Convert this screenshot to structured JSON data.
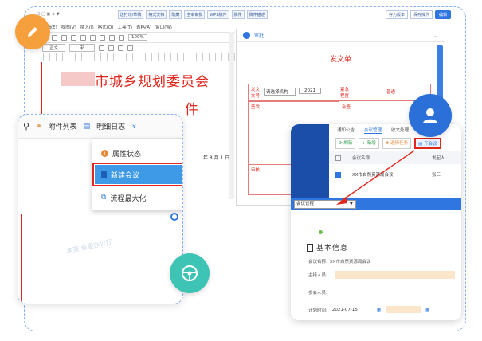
{
  "title_bar": {
    "buttons": [
      "送打印/草稿",
      "格式文档",
      "隐藏",
      "主宰审批",
      "WPS稿件",
      "稿件",
      "稿件描述",
      "打印排版",
      "待审文件",
      "稿案"
    ],
    "right_buttons": [
      "存为版本",
      "保存操作"
    ],
    "highlight_button": "编辑"
  },
  "word_editor": {
    "menu": [
      "编辑(E)",
      "视图(V)",
      "插入(I)",
      "格式(O)",
      "工具(T)",
      "表格(A)",
      "窗口(W)",
      "帮助(H)"
    ],
    "zoom": "100%",
    "style_box": "正文",
    "font_box": "宋",
    "size_box": "五号",
    "doc_title_line1": "市城乡规划委员会",
    "doc_title_line2": "件",
    "date_text": "年 8 月 1 日"
  },
  "approval_form": {
    "header_label": "审批",
    "title": "发文单",
    "fields": {
      "doc_no_label": "发文\n文号",
      "doc_no_select": "请选择机构",
      "year_select": "2021",
      "urgency_label": "紧急\n程度",
      "urgency_value": "普通",
      "signer_label": "签发",
      "countersign_label": "会签",
      "review_label": "审核"
    }
  },
  "popup": {
    "tabs": [
      "附件列表",
      "明细日志"
    ],
    "dropdown_icon": "»",
    "menu": [
      {
        "label": "属性状态",
        "icon": "info-icon"
      },
      {
        "label": "新建会议",
        "icon": "new-doc-icon"
      },
      {
        "label": "流程最大化",
        "icon": "flow-icon"
      }
    ],
    "watermark": "李英 省委办公厅"
  },
  "meeting_app": {
    "tabs": [
      "通知公告",
      "会议管理",
      "收文处理"
    ],
    "toolbar": [
      "刷新",
      "新增",
      "选择任务",
      "开会议"
    ],
    "table_headers": [
      "会议名称",
      "发起人"
    ],
    "row": {
      "name": "XX市自然资源局会议",
      "initiator": "张三"
    },
    "dropdown": "会议议程",
    "section_title": "基本信息",
    "form": {
      "meeting_name_label": "会议名称:",
      "meeting_name_value": "XX市自然资源局会议",
      "host_label": "主持人员:",
      "attendee_label": "参会人员:",
      "time_label": "计划时间:",
      "time_value": "2021-07-15"
    }
  },
  "colors": {
    "accent_blue": "#2f76e0",
    "red": "#e1261c",
    "orange_circle": "#f5a03c",
    "teal_circle": "#3ec4b4",
    "blue_circle": "#2b6fd8"
  }
}
